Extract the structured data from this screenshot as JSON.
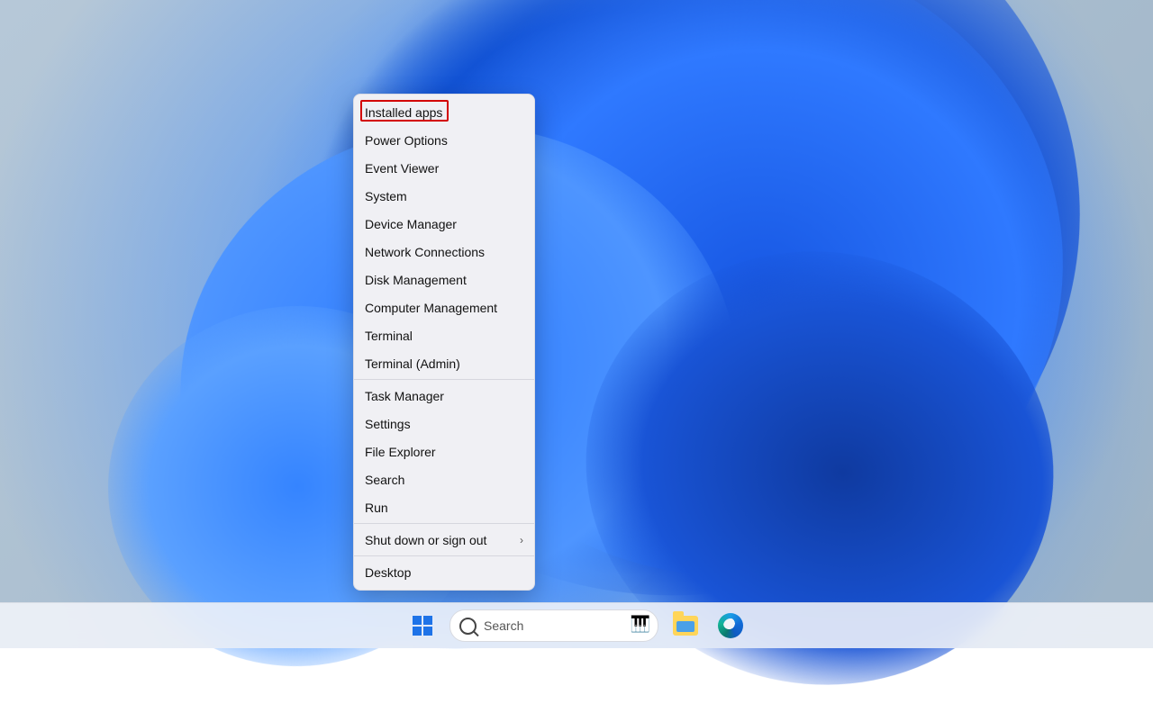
{
  "context_menu": {
    "highlighted_index": 0,
    "groups": [
      {
        "items": [
          {
            "id": "installed-apps",
            "label": "Installed apps"
          },
          {
            "id": "power-options",
            "label": "Power Options"
          },
          {
            "id": "event-viewer",
            "label": "Event Viewer"
          },
          {
            "id": "system",
            "label": "System"
          },
          {
            "id": "device-manager",
            "label": "Device Manager"
          },
          {
            "id": "network-connections",
            "label": "Network Connections"
          },
          {
            "id": "disk-management",
            "label": "Disk Management"
          },
          {
            "id": "computer-management",
            "label": "Computer Management"
          },
          {
            "id": "terminal",
            "label": "Terminal"
          },
          {
            "id": "terminal-admin",
            "label": "Terminal (Admin)"
          }
        ]
      },
      {
        "items": [
          {
            "id": "task-manager",
            "label": "Task Manager"
          },
          {
            "id": "settings",
            "label": "Settings"
          },
          {
            "id": "file-explorer",
            "label": "File Explorer"
          },
          {
            "id": "search",
            "label": "Search"
          },
          {
            "id": "run",
            "label": "Run"
          }
        ]
      },
      {
        "items": [
          {
            "id": "shut-down-or-sign-out",
            "label": "Shut down or sign out",
            "submenu": true
          }
        ]
      },
      {
        "items": [
          {
            "id": "desktop",
            "label": "Desktop"
          }
        ]
      }
    ]
  },
  "taskbar": {
    "search_placeholder": "Search",
    "icons": [
      {
        "id": "start",
        "name": "start-button"
      },
      {
        "id": "search",
        "name": "search-box"
      },
      {
        "id": "file-explorer",
        "name": "file-explorer-icon"
      },
      {
        "id": "edge",
        "name": "microsoft-edge-icon"
      }
    ]
  },
  "annotation": {
    "highlight_color": "#d30000"
  }
}
